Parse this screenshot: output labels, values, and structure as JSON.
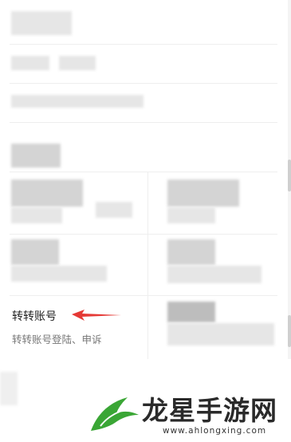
{
  "transfer": {
    "title": "转转账号",
    "subtitle": "转转账号登陆、申诉",
    "arrow_color": "#e53935"
  },
  "watermark": {
    "brand": "龙星手游网",
    "url": "www.ahlongxing.com",
    "logo_color": "#3aa635"
  },
  "icons": [
    "arrow-left-icon",
    "dragon-logo-icon"
  ]
}
